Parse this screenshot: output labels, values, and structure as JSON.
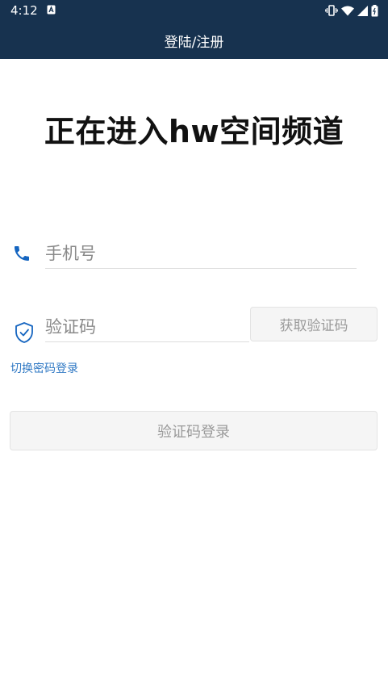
{
  "status_bar": {
    "time": "4:12",
    "icons": [
      "notification-a-icon",
      "vibrate-icon",
      "wifi-icon",
      "cell-signal-icon",
      "battery-icon"
    ]
  },
  "header": {
    "title": "登陆/注册",
    "background": "#17324f"
  },
  "main": {
    "title": "正在进入hw空间频道",
    "phone": {
      "icon": "phone-icon",
      "placeholder": "手机号",
      "value": ""
    },
    "code": {
      "icon": "shield-check-icon",
      "placeholder": "验证码",
      "value": ""
    },
    "get_code_label": "获取验证码",
    "switch_label": "切换密码登录",
    "login_label": "验证码登录",
    "accent": "#2f78c4"
  }
}
